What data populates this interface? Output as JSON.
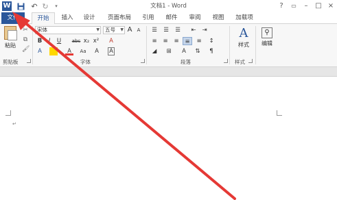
{
  "window": {
    "title": "文档1 - Word"
  },
  "qat": {
    "undo": "↶",
    "redo": "↻"
  },
  "window_controls": {
    "help": "?",
    "minimize": "–",
    "maximize": "□",
    "close": "×"
  },
  "tabs": [
    {
      "label": "文件"
    },
    {
      "label": "开始"
    },
    {
      "label": "插入"
    },
    {
      "label": "设计"
    },
    {
      "label": "页面布局"
    },
    {
      "label": "引用"
    },
    {
      "label": "邮件"
    },
    {
      "label": "审阅"
    },
    {
      "label": "视图"
    },
    {
      "label": "加载项"
    }
  ],
  "ribbon": {
    "clipboard": {
      "paste_label": "粘贴",
      "group_label": "剪贴板"
    },
    "font": {
      "font_name": "宋体",
      "font_size": "五号",
      "group_label": "字体",
      "bold": "B",
      "italic": "I",
      "underline": "U",
      "strike": "abc",
      "sub": "x₂",
      "sup": "x²",
      "grow": "A",
      "shrink": "A",
      "case": "Aa",
      "clear": "A",
      "color_a": "A",
      "char_border": "A"
    },
    "paragraph": {
      "group_label": "段落"
    },
    "styles": {
      "label": "样式",
      "group_label": "样式"
    },
    "editing": {
      "label": "编辑"
    }
  },
  "document": {
    "paragraph_mark": "↵"
  },
  "colors": {
    "brand": "#2b579a",
    "arrow": "#e53935"
  }
}
